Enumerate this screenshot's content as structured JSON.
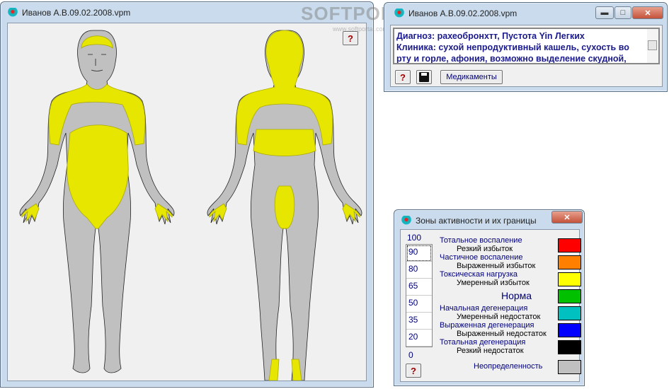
{
  "main_window": {
    "title": "Иванов А.В.09.02.2008.vpm",
    "help_label": "?"
  },
  "watermark": {
    "text": "SOFTPORTAL",
    "sub": "www.softportal.com"
  },
  "diagnosis_window": {
    "title": "Иванов А.В.09.02.2008.vpm",
    "lines": [
      "Диагноз: рахеобронхтт,  Пустота Yin Легких",
      "Клиника: сухой непродуктивный кашель, сухость во",
      "рту и горле, афония, возможно выделение скудной,"
    ],
    "help_label": "?",
    "medications_label": "Медикаменты",
    "minimize": "▬",
    "maximize": "□",
    "close": "✕"
  },
  "zones_window": {
    "title": "Зоны активности и их границы",
    "close": "✕",
    "help_label": "?",
    "top_value": "100",
    "bottom_value": "0",
    "thresholds": [
      "90",
      "80",
      "65",
      "50",
      "35",
      "20"
    ],
    "zones": [
      {
        "heading": "Тотальное воспаление",
        "sub": "Резкий избыток",
        "color": "#ff0000"
      },
      {
        "heading": "Частичное воспаление",
        "sub": "Выраженный избыток",
        "color": "#ff8000"
      },
      {
        "heading": "Токсическая нагрузка",
        "sub": "Умеренный избыток",
        "color": "#ffff00"
      },
      {
        "heading": "",
        "sub": "Норма",
        "color": "#00c000"
      },
      {
        "heading": "Начальная дегенерация",
        "sub": "Умеренный недостаток",
        "color": "#00c0c0"
      },
      {
        "heading": "Выраженная дегенерация",
        "sub": "Выраженный недостаток",
        "color": "#0000ff"
      },
      {
        "heading": "Тотальная дегенерация",
        "sub": "Резкий недостаток",
        "color": "#000000"
      },
      {
        "heading": "",
        "sub": "Неопределенность",
        "color": "#c0c0c0"
      }
    ]
  }
}
